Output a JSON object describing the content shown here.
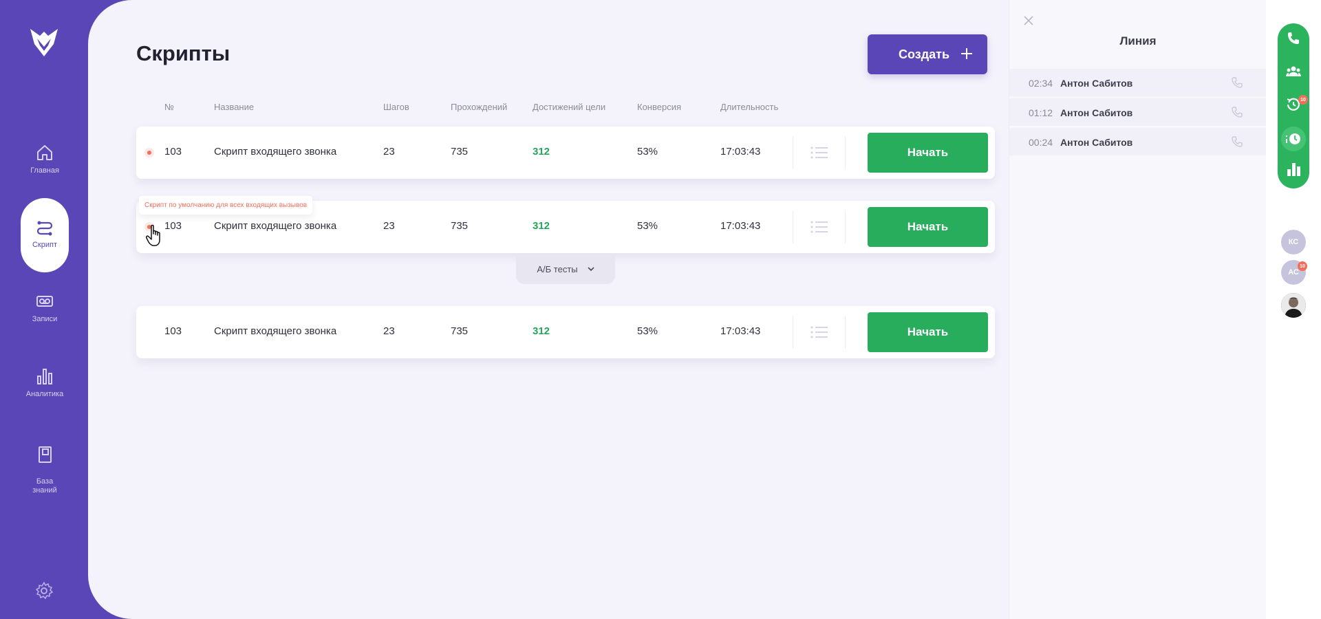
{
  "sidebar": {
    "items": [
      {
        "label": "Главная"
      },
      {
        "label": "Скрипт"
      },
      {
        "label": "Записи"
      },
      {
        "label": "Аналитика"
      },
      {
        "label": "База\nзнаний"
      }
    ]
  },
  "page": {
    "title": "Скрипты",
    "create_label": "Создать"
  },
  "table": {
    "headers": [
      "№",
      "Название",
      "Шагов",
      "Прохождений",
      "Достижений цели",
      "Конверсия",
      "Длительность"
    ],
    "rows": [
      {
        "num": "103",
        "name": "Скрипт входящего звонка",
        "steps": "23",
        "passes": "735",
        "goals": "312",
        "conversion": "53%",
        "duration": "17:03:43",
        "action": "Начать"
      },
      {
        "num": "103",
        "name": "Скрипт входящего звонка",
        "steps": "23",
        "passes": "735",
        "goals": "312",
        "conversion": "53%",
        "duration": "17:03:43",
        "action": "Начать"
      },
      {
        "num": "103",
        "name": "Скрипт входящего звонка",
        "steps": "23",
        "passes": "735",
        "goals": "312",
        "conversion": "53%",
        "duration": "17:03:43",
        "action": "Начать"
      }
    ],
    "tooltip": "Скрипт по умолчанию для всех входящих вызывов",
    "ab_tests_label": "А/Б тесты"
  },
  "line_panel": {
    "title": "Линия",
    "calls": [
      {
        "time": "02:34",
        "name": "Антон Сабитов"
      },
      {
        "time": "01:12",
        "name": "Антон Сабитов"
      },
      {
        "time": "00:24",
        "name": "Антон Сабитов"
      }
    ]
  },
  "right_strip": {
    "badge_count": "10",
    "avatars": [
      {
        "initials": "КС"
      },
      {
        "initials": "АС",
        "badge": "10"
      }
    ]
  },
  "colors": {
    "brand": "#5a46b6",
    "success": "#28ad5c",
    "accent_red": "#ef6f5a",
    "background": "#f4f3fb"
  }
}
